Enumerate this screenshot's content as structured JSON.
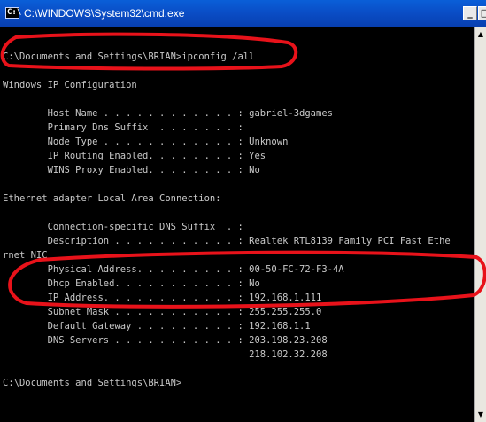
{
  "window": {
    "title": "C:\\WINDOWS\\System32\\cmd.exe",
    "icon_text": "C:\\",
    "minimize_glyph": "_",
    "maximize_glyph": "□",
    "scroll_up_glyph": "▲",
    "scroll_down_glyph": "▼"
  },
  "console": {
    "lines": [
      "",
      "C:\\Documents and Settings\\BRIAN>ipconfig /all",
      "",
      "Windows IP Configuration",
      "",
      "        Host Name . . . . . . . . . . . . : gabriel-3dgames",
      "        Primary Dns Suffix  . . . . . . . :",
      "        Node Type . . . . . . . . . . . . : Unknown",
      "        IP Routing Enabled. . . . . . . . : Yes",
      "        WINS Proxy Enabled. . . . . . . . : No",
      "",
      "Ethernet adapter Local Area Connection:",
      "",
      "        Connection-specific DNS Suffix  . :",
      "        Description . . . . . . . . . . . : Realtek RTL8139 Family PCI Fast Ethe",
      "rnet NIC",
      "        Physical Address. . . . . . . . . : 00-50-FC-72-F3-4A",
      "        Dhcp Enabled. . . . . . . . . . . : No",
      "        IP Address. . . . . . . . . . . . : 192.168.1.111",
      "        Subnet Mask . . . . . . . . . . . : 255.255.255.0",
      "        Default Gateway . . . . . . . . . : 192.168.1.1",
      "        DNS Servers . . . . . . . . . . . : 203.198.23.208",
      "                                            218.102.32.208",
      "",
      "C:\\Documents and Settings\\BRIAN>"
    ]
  },
  "annotation_color": "#e8121a"
}
